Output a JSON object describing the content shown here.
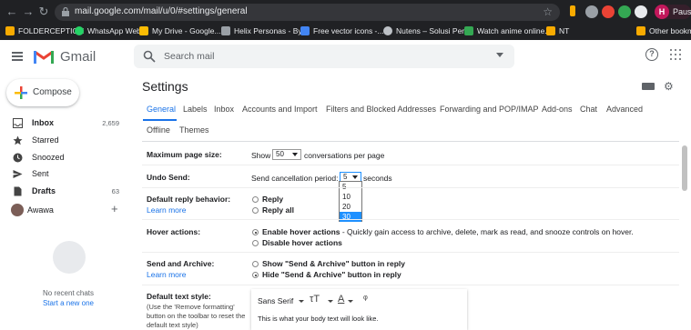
{
  "browser": {
    "url": "mail.google.com/mail/u/0/#settings/general",
    "profile_initial": "H",
    "profile_name": "Paused",
    "bookmarks": [
      {
        "label": "FOLDERCEPTION",
        "color": "#f9ab00"
      },
      {
        "label": "WhatsApp Web",
        "color": "#25d366"
      },
      {
        "label": "My Drive - Google...",
        "color": "#fbbc04"
      },
      {
        "label": "Helix Personas - By...",
        "color": "#9aa0a6"
      },
      {
        "label": "Free vector icons -...",
        "color": "#4285f4"
      },
      {
        "label": "Nutens – Solusi Per...",
        "color": "#bdc1c6"
      },
      {
        "label": "Watch anime online...",
        "color": "#34a853"
      },
      {
        "label": "NT",
        "color": "#f9ab00"
      },
      {
        "label": "Other bookmarks",
        "color": "#f9ab00"
      }
    ]
  },
  "header": {
    "app_name": "Gmail",
    "search_placeholder": "Search mail"
  },
  "sidebar": {
    "compose_label": "Compose",
    "items": [
      {
        "label": "Inbox",
        "count": "2,659",
        "bold": true,
        "icon": "inbox-icon"
      },
      {
        "label": "Starred",
        "count": "",
        "bold": false,
        "icon": "star-icon"
      },
      {
        "label": "Snoozed",
        "count": "",
        "bold": false,
        "icon": "clock-icon"
      },
      {
        "label": "Sent",
        "count": "",
        "bold": false,
        "icon": "send-icon"
      },
      {
        "label": "Drafts",
        "count": "63",
        "bold": true,
        "icon": "draft-icon"
      }
    ],
    "user_name": "Awawa",
    "no_chats": "No recent chats",
    "start_chat": "Start a new one"
  },
  "settings": {
    "title": "Settings",
    "tabs": [
      "General",
      "Labels",
      "Inbox",
      "Accounts and Import",
      "Filters and Blocked Addresses",
      "Forwarding and POP/IMAP",
      "Add-ons",
      "Chat",
      "Advanced",
      "Offline",
      "Themes"
    ],
    "max_page_size": {
      "label": "Maximum page size:",
      "prefix": "Show",
      "value": "50",
      "suffix": "conversations per page"
    },
    "undo_send": {
      "label": "Undo Send:",
      "prefix": "Send cancellation period:",
      "value": "5",
      "suffix": "seconds",
      "options": [
        "5",
        "10",
        "20",
        "30"
      ],
      "highlighted": "30"
    },
    "reply_behavior": {
      "label": "Default reply behavior:",
      "learn_more": "Learn more",
      "options": [
        "Reply",
        "Reply all"
      ]
    },
    "hover_actions": {
      "label": "Hover actions:",
      "enable": "Enable hover actions",
      "enable_desc": " - Quickly gain access to archive, delete, mark as read, and snooze controls on hover.",
      "disable": "Disable hover actions"
    },
    "send_archive": {
      "label": "Send and Archive:",
      "learn_more": "Learn more",
      "show": "Show \"Send & Archive\" button in reply",
      "hide": "Hide \"Send & Archive\" button in reply"
    },
    "text_style": {
      "label": "Default text style:",
      "help": "(Use the 'Remove formatting' button on the toolbar to reset the default text style)",
      "font": "Sans Serif",
      "preview": "This is what your body text will look like."
    }
  }
}
